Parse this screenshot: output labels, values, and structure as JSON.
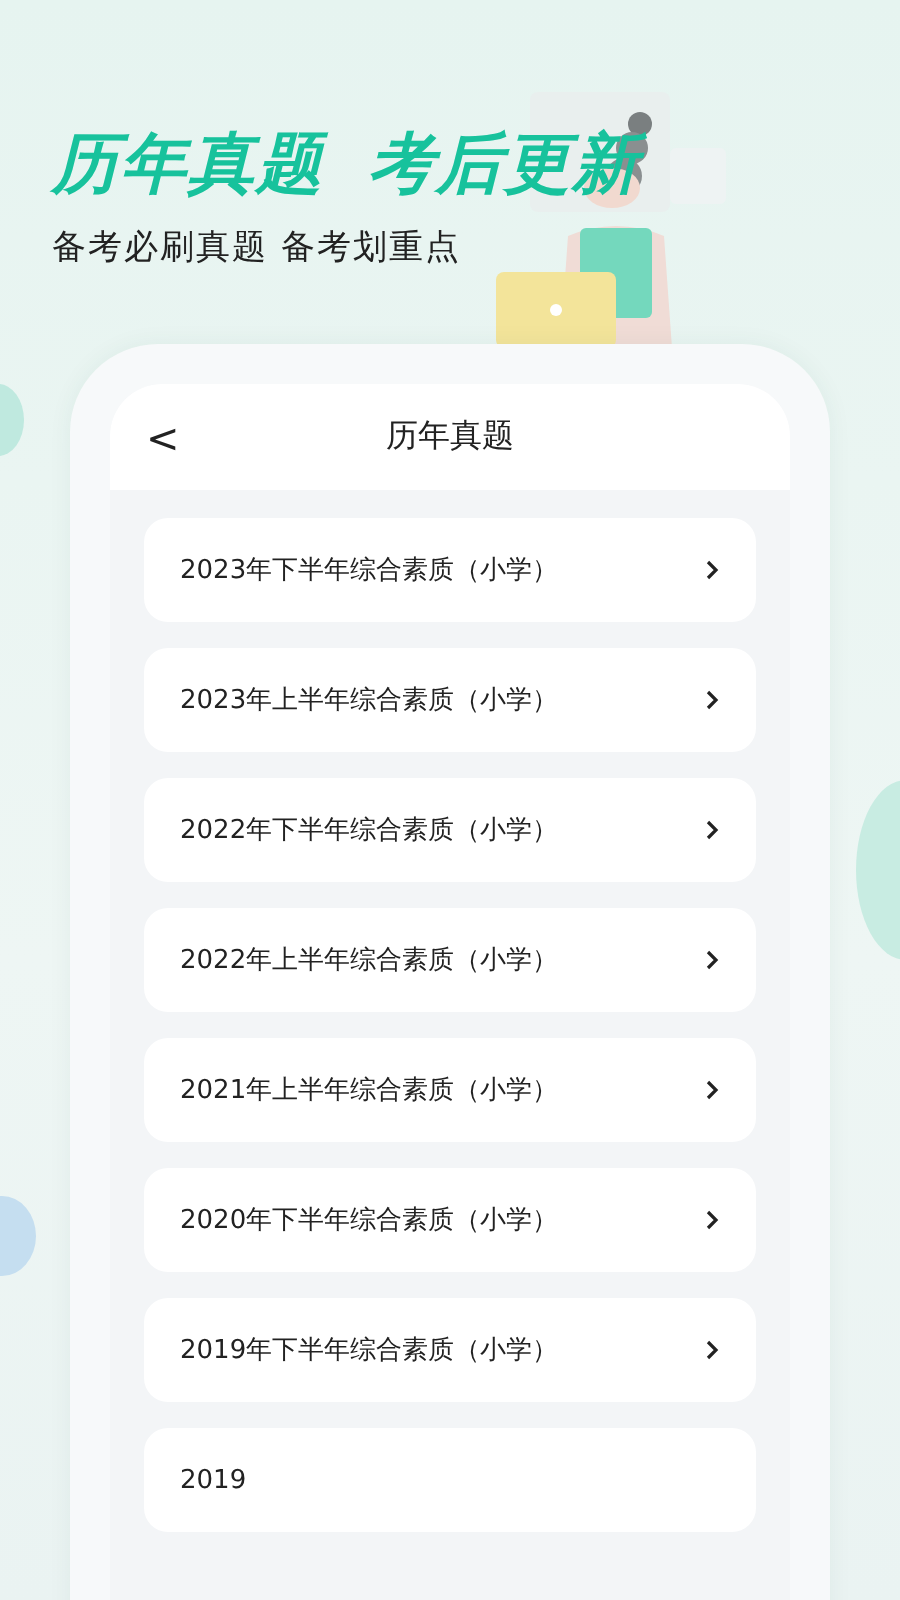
{
  "headline": {
    "left": "历年真题",
    "right": "考后更新"
  },
  "subtitle": "备考必刷真题 备考划重点",
  "screen": {
    "back": "<",
    "title": "历年真题",
    "items": [
      {
        "label": "2023年下半年综合素质（小学）",
        "partial": false
      },
      {
        "label": "2023年上半年综合素质（小学）",
        "partial": false
      },
      {
        "label": "2022年下半年综合素质（小学）",
        "partial": false
      },
      {
        "label": "2022年上半年综合素质（小学）",
        "partial": false
      },
      {
        "label": "2021年上半年综合素质（小学）",
        "partial": false
      },
      {
        "label": "2020年下半年综合素质（小学）",
        "partial": false
      },
      {
        "label": "2019年下半年综合素质（小学）",
        "partial": false
      },
      {
        "label": "2019",
        "partial": true
      }
    ]
  }
}
